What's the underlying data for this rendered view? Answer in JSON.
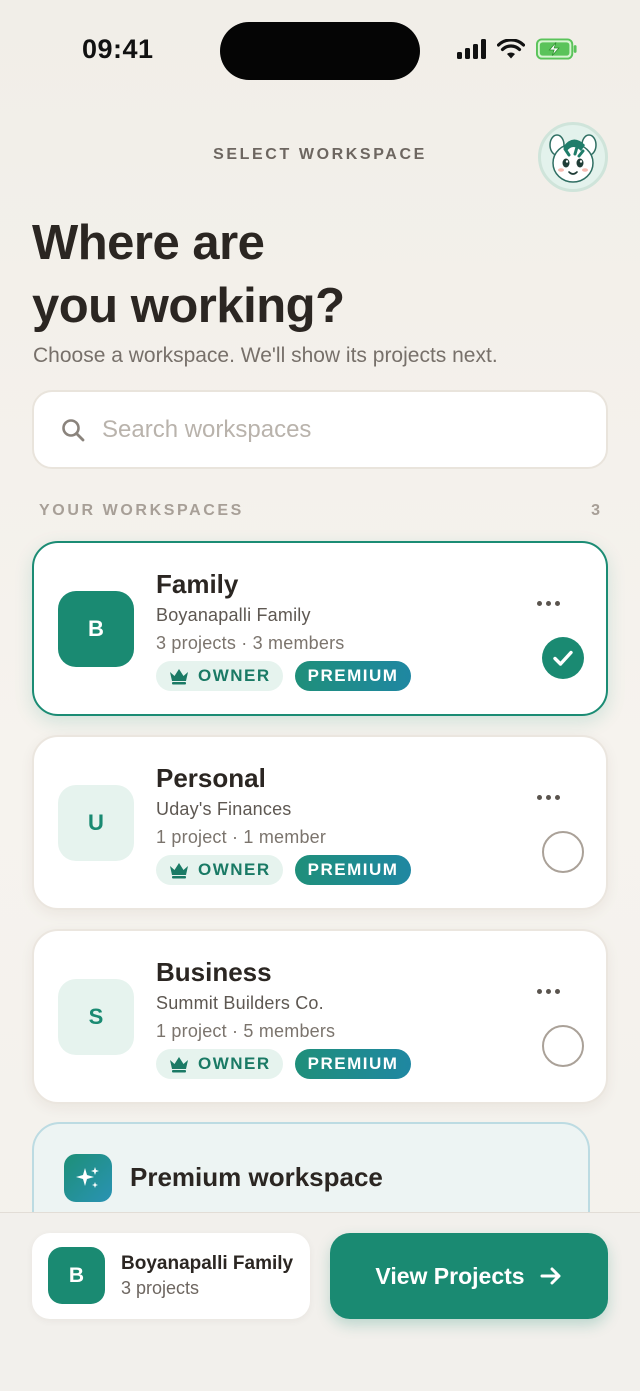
{
  "status_bar": {
    "time": "09:41",
    "icons": [
      "signal-icon",
      "wifi-icon",
      "battery-charging-icon"
    ]
  },
  "header": {
    "label": "SELECT WORKSPACE",
    "avatar_icon": "zebra-mascot-avatar"
  },
  "hero": {
    "title": "Where are\nyou working?",
    "subtitle": "Choose a workspace. We'll show its projects next."
  },
  "search": {
    "placeholder": "Search workspaces",
    "value": ""
  },
  "section": {
    "label": "YOUR WORKSPACES",
    "count": "3"
  },
  "workspaces": [
    {
      "letter": "B",
      "name": "Family",
      "subtitle": "Boyanapalli Family",
      "meta": "3 projects · 3 members",
      "owner_badge": "OWNER",
      "premium_badge": "PREMIUM",
      "selected": true
    },
    {
      "letter": "U",
      "name": "Personal",
      "subtitle": "Uday's Finances",
      "meta": "1 project · 1 member",
      "owner_badge": "OWNER",
      "premium_badge": "PREMIUM",
      "selected": false
    },
    {
      "letter": "S",
      "name": "Business",
      "subtitle": "Summit Builders Co.",
      "meta": "1 project · 5 members",
      "owner_badge": "OWNER",
      "premium_badge": "PREMIUM",
      "selected": false
    }
  ],
  "premium_promo": {
    "title": "Premium workspace",
    "icon": "sparkles-icon"
  },
  "footer": {
    "selected_letter": "B",
    "selected_name": "Boyanapalli Family",
    "selected_meta": "3 projects",
    "cta_label": "View Projects"
  },
  "colors": {
    "accent": "#1a8a72",
    "premium_gradient_end": "#1f87a2",
    "background": "#f3f0eb"
  }
}
